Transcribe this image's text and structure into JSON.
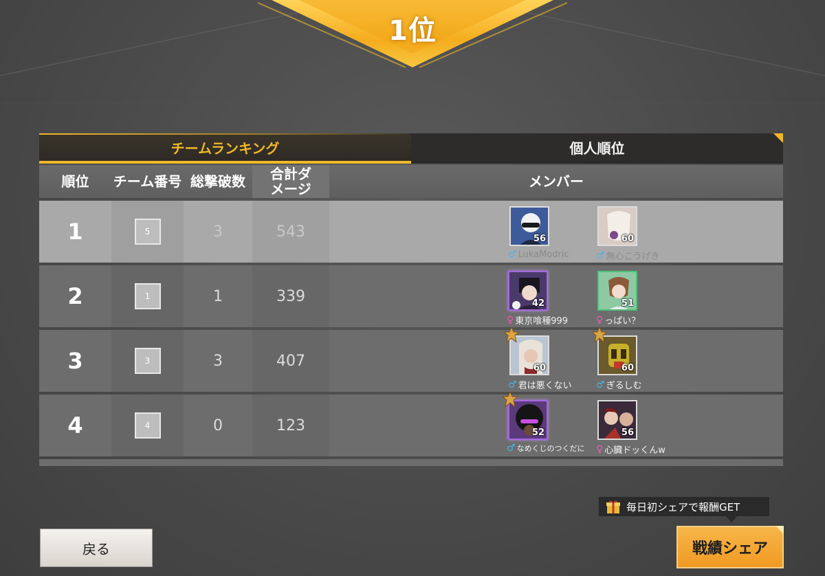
{
  "banner": {
    "rank_label": "1位"
  },
  "tabs": [
    {
      "label": "チームランキング",
      "active": true
    },
    {
      "label": "個人順位",
      "active": false
    }
  ],
  "table": {
    "headers": {
      "rank": "順位",
      "team_no": "チーム番号",
      "kills": "総撃破数",
      "damage": "合計ダメージ",
      "members": "メンバー"
    },
    "rows": [
      {
        "rank": "1",
        "team_no": "5",
        "kills": "3",
        "damage": "543",
        "selected": true,
        "members": [
          {
            "name": "LukaModric",
            "gender": "male",
            "level": "56"
          },
          {
            "name": "無心こうげき",
            "gender": "male",
            "level": "60"
          }
        ]
      },
      {
        "rank": "2",
        "team_no": "1",
        "kills": "1",
        "damage": "339",
        "selected": false,
        "members": [
          {
            "name": "東京喰種999",
            "gender": "female",
            "level": "42"
          },
          {
            "name": "っぱい？",
            "gender": "female",
            "level": "51"
          }
        ]
      },
      {
        "rank": "3",
        "team_no": "3",
        "kills": "3",
        "damage": "407",
        "selected": false,
        "members": [
          {
            "name": "君は悪くない",
            "gender": "male",
            "level": "60"
          },
          {
            "name": "ぎるしむ",
            "gender": "male",
            "level": "60"
          }
        ]
      },
      {
        "rank": "4",
        "team_no": "4",
        "kills": "0",
        "damage": "123",
        "selected": false,
        "members": [
          {
            "name": "なめくじのつくだに",
            "gender": "male",
            "level": "52"
          },
          {
            "name": "心臓ドッくんw",
            "gender": "female",
            "level": "56"
          }
        ]
      }
    ]
  },
  "footer": {
    "back_label": "戻る",
    "share_tip": "毎日初シェアで報酬GET",
    "share_label": "戦績シェア"
  },
  "colors": {
    "accent": "#f0b92a",
    "share_button": "#f09a22",
    "male": "#45b6e8",
    "female": "#ef5aa8"
  },
  "icons": {
    "gender_male": "male-symbol",
    "gender_female": "female-symbol",
    "gift": "gift-icon"
  }
}
